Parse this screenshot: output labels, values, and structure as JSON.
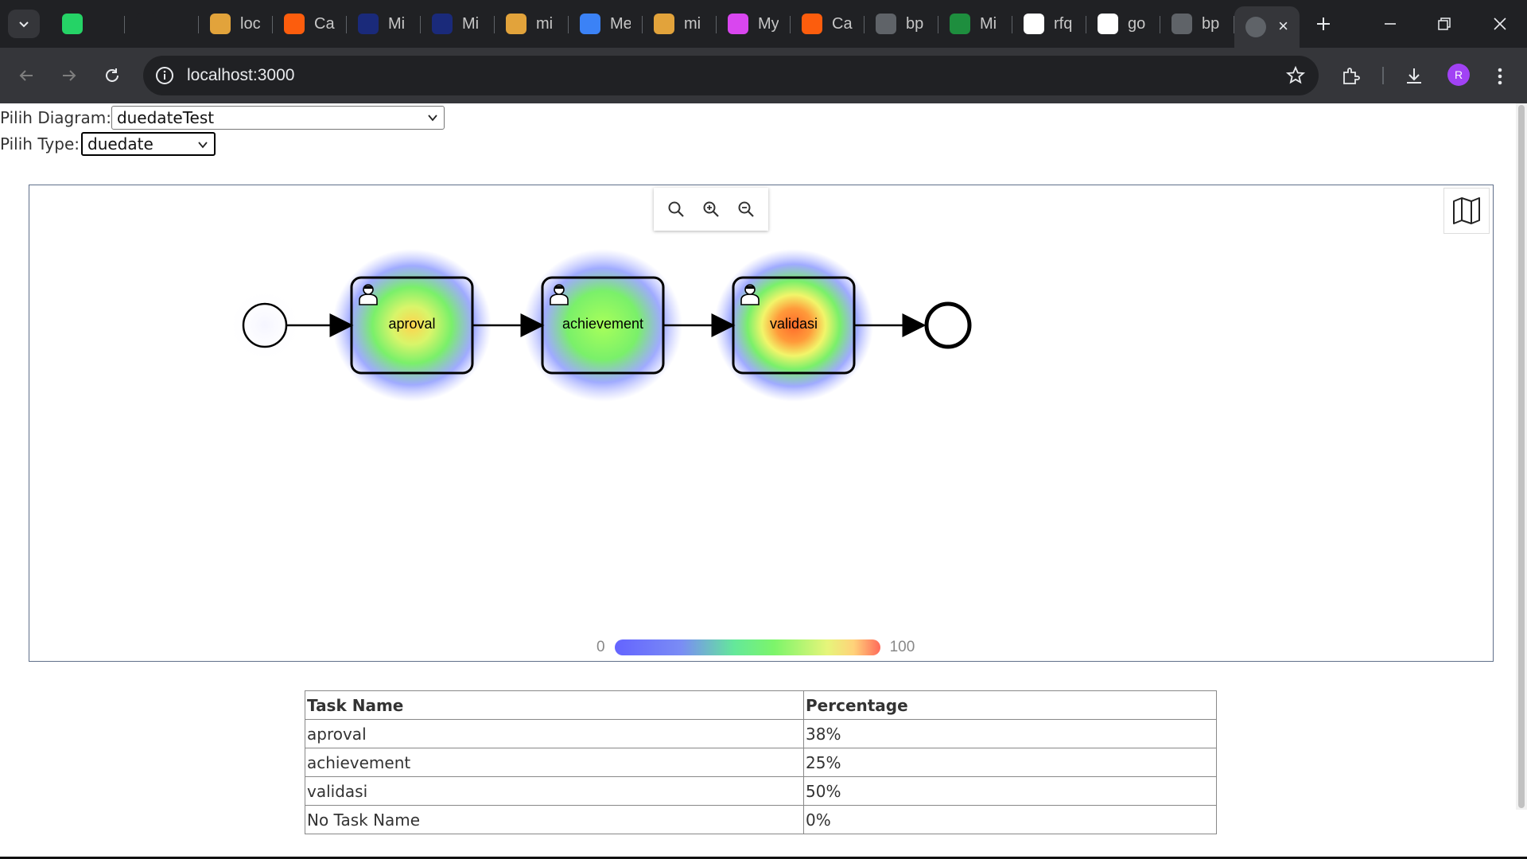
{
  "browser": {
    "tabs": [
      {
        "label": "",
        "icon": "whatsapp-icon",
        "color": "#25d366"
      },
      {
        "label": "",
        "icon": "chatgpt-icon",
        "color": "#202124"
      },
      {
        "label": "loc",
        "icon": "gitlab-like-icon",
        "color": "#e2a33b"
      },
      {
        "label": "Ca",
        "icon": "camunda-icon",
        "color": "#fc5d0d"
      },
      {
        "label": "Mi",
        "icon": "mirror-icon",
        "color": "#1a2a7a"
      },
      {
        "label": "Mi",
        "icon": "mirror-icon",
        "color": "#1a2a7a"
      },
      {
        "label": "mi",
        "icon": "gitlab-like-icon",
        "color": "#e2a33b"
      },
      {
        "label": "Me",
        "icon": "grid-doc-icon",
        "color": "#3b82f6"
      },
      {
        "label": "mi",
        "icon": "gitlab-like-icon",
        "color": "#e2a33b"
      },
      {
        "label": "My",
        "icon": "m-logo-icon",
        "color": "#d946ef"
      },
      {
        "label": "Ca",
        "icon": "camunda-icon",
        "color": "#fc5d0d"
      },
      {
        "label": "bp",
        "icon": "globe-icon",
        "color": "#5f6368"
      },
      {
        "label": "Mi",
        "icon": "plus-sheet-icon",
        "color": "#1e8e3e"
      },
      {
        "label": "rfq",
        "icon": "github-icon",
        "color": "#ffffff"
      },
      {
        "label": "go",
        "icon": "google-icon",
        "color": "#ffffff"
      },
      {
        "label": "bp",
        "icon": "globe-icon",
        "color": "#5f6368"
      }
    ],
    "active_tab": {
      "label": "",
      "icon": "globe-icon"
    },
    "url": "localhost:3000",
    "profile_initial": "R"
  },
  "form": {
    "diagram_label": "Pilih Diagram:",
    "diagram_value": "duedateTest",
    "type_label": "Pilih Type:",
    "type_value": "duedate"
  },
  "diagram": {
    "tasks": [
      {
        "name": "aproval",
        "heat": 38
      },
      {
        "name": "achievement",
        "heat": 25
      },
      {
        "name": "validasi",
        "heat": 50
      }
    ],
    "legend_min": "0",
    "legend_max": "100"
  },
  "table": {
    "headers": [
      "Task Name",
      "Percentage"
    ],
    "rows": [
      [
        "aproval",
        "38%"
      ],
      [
        "achievement",
        "25%"
      ],
      [
        "validasi",
        "50%"
      ],
      [
        "No Task Name",
        "0%"
      ]
    ]
  }
}
